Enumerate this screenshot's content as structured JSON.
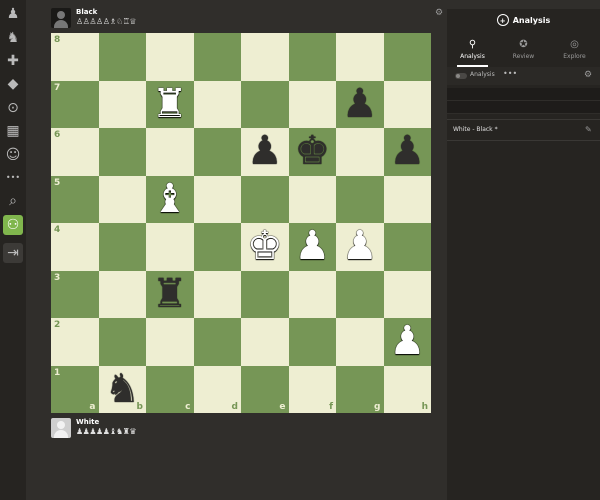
{
  "sidebar": {
    "items": [
      {
        "name": "chesscom-logo-icon",
        "glyph": "♟"
      },
      {
        "name": "play-icon",
        "glyph": "♞"
      },
      {
        "name": "puzzles-icon",
        "glyph": "✚"
      },
      {
        "name": "learn-icon",
        "glyph": "◆"
      },
      {
        "name": "watch-icon",
        "glyph": "⊙"
      },
      {
        "name": "news-icon",
        "glyph": "▦"
      },
      {
        "name": "social-icon",
        "glyph": "☺"
      },
      {
        "name": "more-icon",
        "glyph": "•••"
      },
      {
        "name": "search-icon",
        "glyph": "⌕"
      },
      {
        "name": "analysis-active-icon",
        "glyph": "⚇"
      },
      {
        "name": "login-icon",
        "glyph": "⇥"
      }
    ]
  },
  "top_player": {
    "name": "Black",
    "captured": "♙♙♙♙♙♗♘♖♕"
  },
  "bottom_player": {
    "name": "White",
    "captured": "♟♟♟♟♟♝♞♜♛"
  },
  "board": {
    "light_color": "#eeeed2",
    "dark_color": "#769656",
    "ranks": [
      "8",
      "7",
      "6",
      "5",
      "4",
      "3",
      "2",
      "1"
    ],
    "files": [
      "a",
      "b",
      "c",
      "d",
      "e",
      "f",
      "g",
      "h"
    ],
    "pieces": [
      {
        "square": "c7",
        "color": "w",
        "type": "rook",
        "glyph": "♜"
      },
      {
        "square": "g7",
        "color": "b",
        "type": "pawn",
        "glyph": "♟"
      },
      {
        "square": "e6",
        "color": "b",
        "type": "pawn",
        "glyph": "♟"
      },
      {
        "square": "f6",
        "color": "b",
        "type": "king",
        "glyph": "♚"
      },
      {
        "square": "h6",
        "color": "b",
        "type": "pawn",
        "glyph": "♟"
      },
      {
        "square": "c5",
        "color": "w",
        "type": "bishop",
        "glyph": "♝"
      },
      {
        "square": "e4",
        "color": "w",
        "type": "king",
        "glyph": "♚"
      },
      {
        "square": "f4",
        "color": "w",
        "type": "pawn",
        "glyph": "♟"
      },
      {
        "square": "g4",
        "color": "w",
        "type": "pawn",
        "glyph": "♟"
      },
      {
        "square": "c3",
        "color": "b",
        "type": "rook",
        "glyph": "♜"
      },
      {
        "square": "h2",
        "color": "w",
        "type": "pawn",
        "glyph": "♟"
      },
      {
        "square": "b1",
        "color": "b",
        "type": "knight",
        "glyph": "♞"
      }
    ]
  },
  "panel": {
    "title": "Analysis",
    "tabs": [
      {
        "label": "Analysis",
        "icon": "analysis-icon",
        "glyph": "⚲",
        "active": true
      },
      {
        "label": "Review",
        "icon": "review-icon",
        "glyph": "✪",
        "active": false
      },
      {
        "label": "Explore",
        "icon": "explore-icon",
        "glyph": "◎",
        "active": false
      }
    ],
    "toolbar": {
      "analysis_label": "Analysis",
      "more": "•••"
    },
    "game_title": "White - Black *"
  }
}
